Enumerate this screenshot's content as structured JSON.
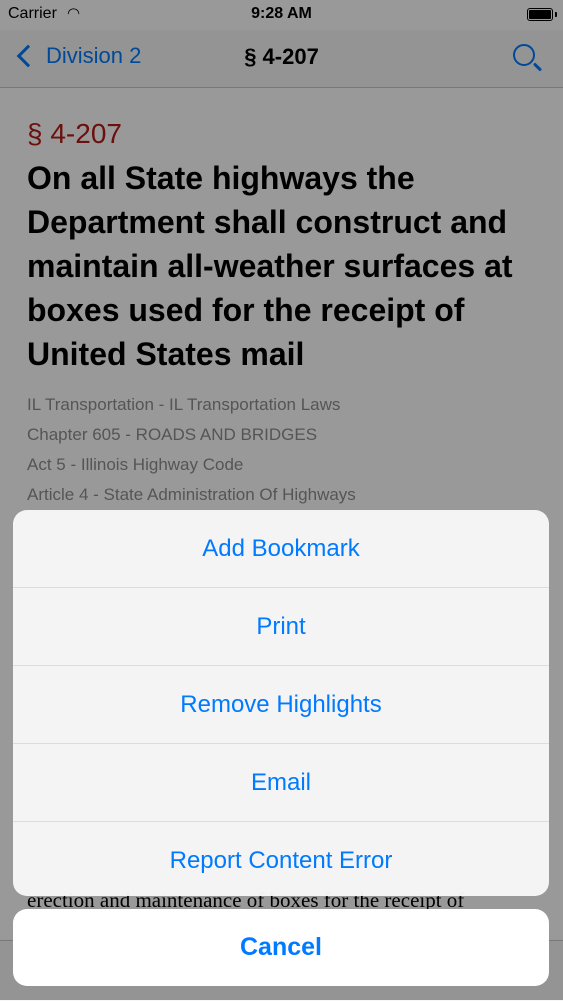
{
  "status": {
    "carrier": "Carrier",
    "time": "9:28 AM"
  },
  "nav": {
    "back_label": "Division 2",
    "title": "§ 4-207"
  },
  "article": {
    "section_number": "§ 4-207",
    "heading": "On all State highways the Department shall construct and maintain all-weather surfaces at boxes used for the receipt of United States mail",
    "breadcrumbs": [
      "IL Transportation - IL Transportation Laws",
      "Chapter 605 - ROADS AND BRIDGES",
      "Act 5 - Illinois Highway Code",
      "Article 4 - State Administration Of Highways"
    ],
    "body_snippet": "erection and maintenance of boxes for the receipt of"
  },
  "action_sheet": {
    "items": [
      "Add Bookmark",
      "Print",
      "Remove Highlights",
      "Email",
      "Report Content Error"
    ],
    "cancel_label": "Cancel"
  }
}
